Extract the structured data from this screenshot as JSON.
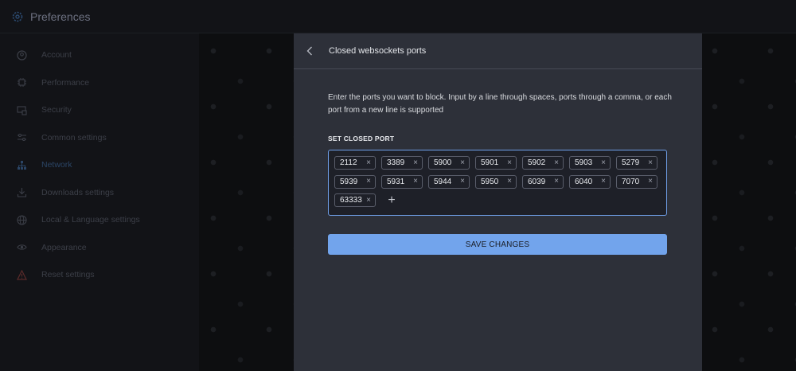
{
  "app": {
    "title": "Preferences",
    "icon": "gear-icon"
  },
  "sidebar": {
    "items": [
      {
        "label": "Account",
        "icon": "user-icon"
      },
      {
        "label": "Performance",
        "icon": "chip-icon"
      },
      {
        "label": "Security",
        "icon": "security-icon"
      },
      {
        "label": "Common settings",
        "icon": "sliders-icon"
      },
      {
        "label": "Network",
        "icon": "network-icon",
        "active": true
      },
      {
        "label": "Downloads settings",
        "icon": "download-icon"
      },
      {
        "label": "Local & Language settings",
        "icon": "globe-icon"
      },
      {
        "label": "Appearance",
        "icon": "eye-icon"
      },
      {
        "label": "Reset settings",
        "icon": "warning-icon"
      }
    ]
  },
  "modal": {
    "title": "Closed websockets ports",
    "description": "Enter the ports you want to block. Input by a line through spaces, ports through a comma, or each port from a new line is supported",
    "section_label": "SET CLOSED PORT",
    "ports": [
      "2112",
      "3389",
      "5900",
      "5901",
      "5902",
      "5903",
      "5279",
      "5939",
      "5931",
      "5944",
      "5950",
      "6039",
      "6040",
      "7070",
      "63333"
    ],
    "remove_symbol": "×",
    "add_symbol": "+",
    "save_label": "SAVE CHANGES"
  },
  "colors": {
    "accent": "#72a4ec",
    "modal_bg": "#2d3039",
    "sidebar_active": "#2b4566",
    "warning": "#5a2a2a"
  }
}
